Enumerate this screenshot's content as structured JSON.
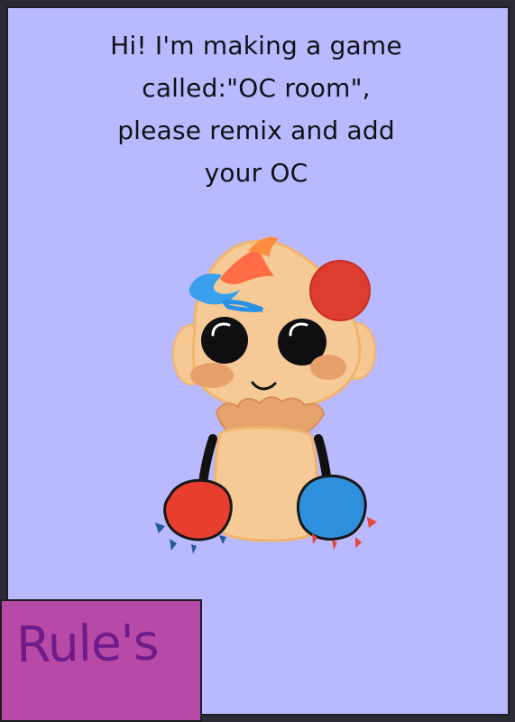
{
  "screen": {
    "title_lines": [
      "Hi! I'm making a game",
      "called:\"OC room\",",
      "please remix and add",
      "your OC"
    ]
  },
  "button": {
    "label": "Rule's"
  },
  "colors": {
    "background": "#b9b9ff",
    "title": "#111116",
    "button_fill": "#b74aa6",
    "button_text": "#6f1c8a"
  }
}
